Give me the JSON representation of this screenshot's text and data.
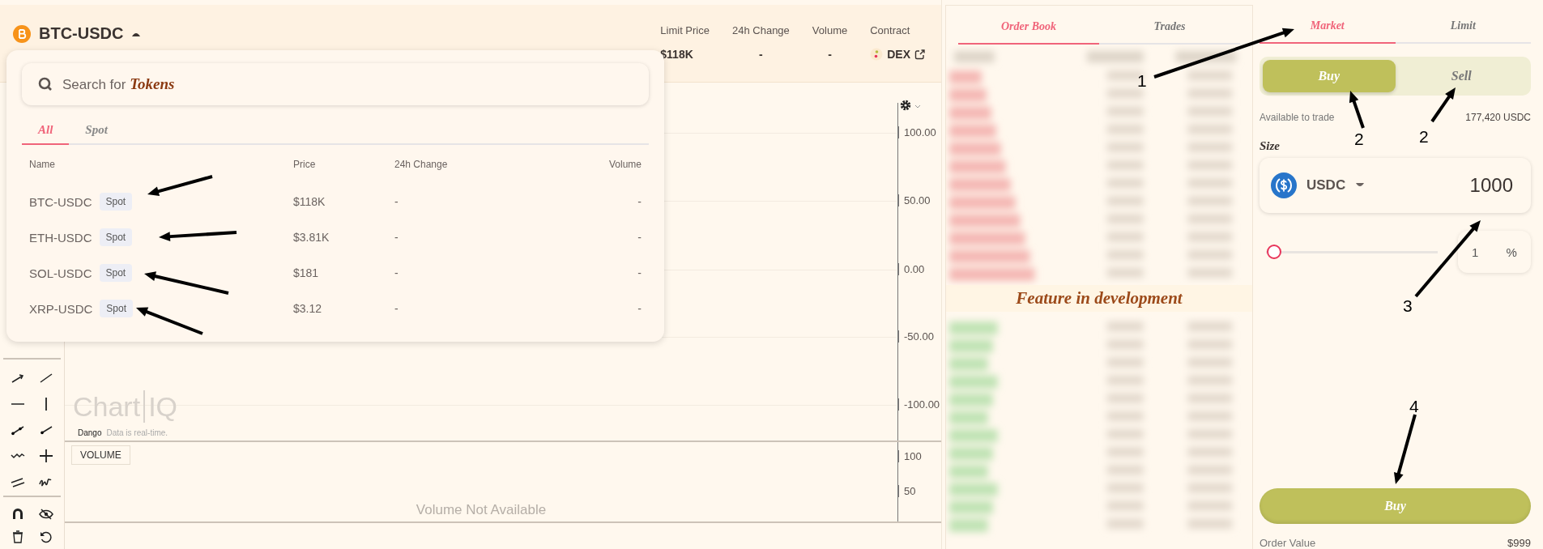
{
  "header": {
    "pair": "BTC-USDC",
    "stats": [
      {
        "label": "Limit Price",
        "value": "$118K"
      },
      {
        "label": "24h Change",
        "value": "-"
      },
      {
        "label": "Volume",
        "value": "-"
      }
    ],
    "contract": {
      "label": "Contract",
      "value": "DEX"
    }
  },
  "token_menu": {
    "placeholder": "Search for *Tokens*",
    "tabs": [
      {
        "label": "All",
        "selected": true
      },
      {
        "label": "Spot",
        "selected": false
      }
    ],
    "columns": [
      "Name",
      "Price",
      "24h Change",
      "Volume"
    ],
    "rows": [
      {
        "name": "BTC-USDC",
        "tag": "Spot",
        "price": "$118K",
        "change": "-",
        "volume": "-"
      },
      {
        "name": "ETH-USDC",
        "tag": "Spot",
        "price": "$3.81K",
        "change": "-",
        "volume": "-"
      },
      {
        "name": "SOL-USDC",
        "tag": "Spot",
        "price": "$181",
        "change": "-",
        "volume": "-"
      },
      {
        "name": "XRP-USDC",
        "tag": "Spot",
        "price": "$3.12",
        "change": "-",
        "volume": "-"
      }
    ]
  },
  "chart": {
    "y_ticks": [
      "100.00",
      "50.00",
      "0.00",
      "-50.00",
      "-100.00"
    ],
    "logo": [
      "Chart",
      "IQ"
    ],
    "source": "Dango",
    "status": "Data is real-time.",
    "study_button": "VOLUME",
    "volume_ticks": [
      "100",
      "50"
    ],
    "volume_message": "Volume Not Available"
  },
  "order_book": {
    "tabs": [
      {
        "label": "Order Book",
        "selected": true
      },
      {
        "label": "Trades",
        "selected": false
      }
    ],
    "notice": "Feature in development"
  },
  "trade": {
    "tabs": [
      {
        "label": "Market",
        "selected": true
      },
      {
        "label": "Limit",
        "selected": false
      }
    ],
    "sides": [
      {
        "label": "Buy",
        "selected": true
      },
      {
        "label": "Sell",
        "selected": false
      }
    ],
    "available_label": "Available to trade",
    "available_value": "177,420 USDC",
    "size_label": "Size",
    "currency": "USDC",
    "amount": "1000",
    "slider": {
      "level": 0.01
    },
    "percent_value": "1",
    "percent_unit": "%",
    "submit": "Buy",
    "order_value_label": "Order Value",
    "order_value": "$999"
  },
  "annotations": [
    {
      "label": "1"
    },
    {
      "label": "2"
    },
    {
      "label": "2"
    },
    {
      "label": "3"
    },
    {
      "label": "4"
    }
  ]
}
